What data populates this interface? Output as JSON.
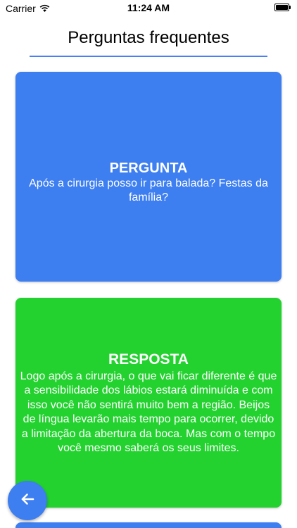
{
  "status_bar": {
    "carrier": "Carrier",
    "time": "11:24 AM"
  },
  "header": {
    "title": "Perguntas frequentes"
  },
  "question_card": {
    "heading": "PERGUNTA",
    "text": "Após a cirurgia posso ir para balada? Festas da família?"
  },
  "answer_card": {
    "heading": "RESPOSTA",
    "text": "Logo após a cirurgia, o que vai ficar diferente é que a sensibilidade dos lábios estará diminuída e com isso você não sentirá muito bem a região. Beijos de língua levarão mais tempo para ocorrer, devido a limitação da abertura da boca. Mas com o tempo você mesmo saberá os seus limites."
  },
  "icons": {
    "wifi": "wifi-icon",
    "battery": "battery-icon",
    "back": "arrow-left-icon"
  },
  "colors": {
    "question_card": "#3d7ef1",
    "answer_card": "#23d22f",
    "accent": "#4a80f0"
  }
}
